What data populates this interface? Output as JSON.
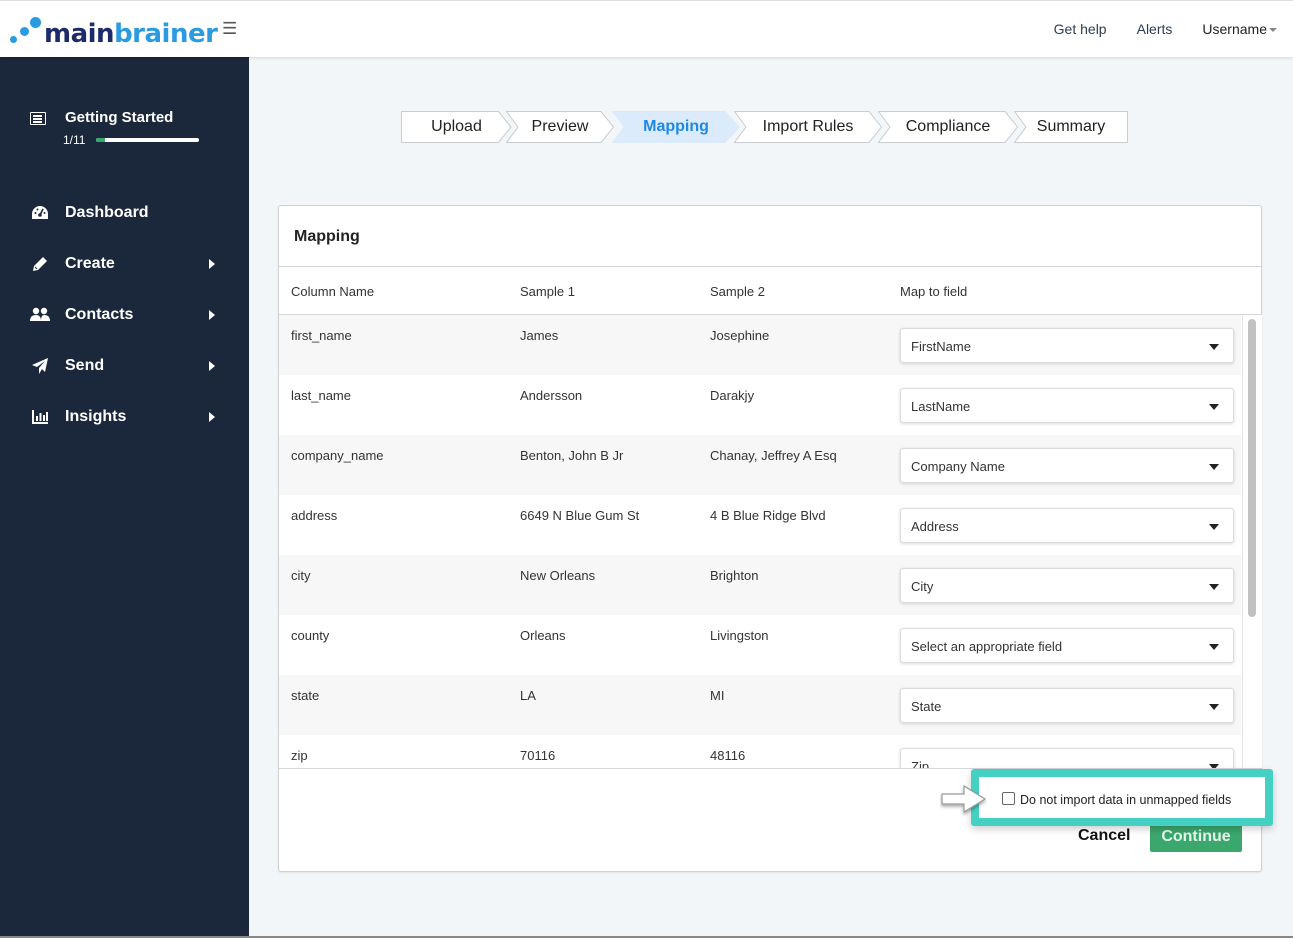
{
  "header": {
    "logo": {
      "part1": "main",
      "part2": "brainer"
    },
    "menu_icon": "hamburger-icon",
    "links": {
      "help": "Get help",
      "alerts": "Alerts",
      "user": "Username"
    }
  },
  "sidebar": {
    "getting_started": {
      "title": "Getting Started",
      "progress_text": "1/11",
      "progress": 0.09
    },
    "items": [
      {
        "label": "Dashboard",
        "icon": "dashboard-icon",
        "has_submenu": false
      },
      {
        "label": "Create",
        "icon": "pencil-icon",
        "has_submenu": true
      },
      {
        "label": "Contacts",
        "icon": "users-icon",
        "has_submenu": true
      },
      {
        "label": "Send",
        "icon": "paper-plane-icon",
        "has_submenu": true
      },
      {
        "label": "Insights",
        "icon": "bar-chart-icon",
        "has_submenu": true
      }
    ]
  },
  "steps": [
    {
      "label": "Upload",
      "active": false
    },
    {
      "label": "Preview",
      "active": false
    },
    {
      "label": "Mapping",
      "active": true
    },
    {
      "label": "Import Rules",
      "active": false
    },
    {
      "label": "Compliance",
      "active": false
    },
    {
      "label": "Summary",
      "active": false
    }
  ],
  "mapping": {
    "title": "Mapping",
    "columns": [
      "Column Name",
      "Sample 1",
      "Sample 2",
      "Map to field"
    ],
    "rows": [
      {
        "column": "first_name",
        "sample1": "James",
        "sample2": "Josephine",
        "field": "FirstName"
      },
      {
        "column": "last_name",
        "sample1": "Andersson",
        "sample2": "Darakjy",
        "field": "LastName"
      },
      {
        "column": "company_name",
        "sample1": "Benton, John B Jr",
        "sample2": "Chanay, Jeffrey A Esq",
        "field": "Company Name"
      },
      {
        "column": "address",
        "sample1": "6649 N Blue Gum St",
        "sample2": "4 B Blue Ridge Blvd",
        "field": "Address"
      },
      {
        "column": "city",
        "sample1": "New Orleans",
        "sample2": "Brighton",
        "field": "City"
      },
      {
        "column": "county",
        "sample1": "Orleans",
        "sample2": "Livingston",
        "field": "Select an appropriate field"
      },
      {
        "column": "state",
        "sample1": "LA",
        "sample2": "MI",
        "field": "State"
      },
      {
        "column": "zip",
        "sample1": "70116",
        "sample2": "48116",
        "field": "Zip"
      }
    ],
    "skip_unmapped": {
      "label": "Do not import data in unmapped fields",
      "checked": false
    },
    "cancel_label": "Cancel",
    "continue_label": "Continue"
  },
  "colors": {
    "accent": "#1e88e5",
    "success": "#3aa76d",
    "highlight": "#45d0c4",
    "sidebar_bg": "#1b283b"
  }
}
